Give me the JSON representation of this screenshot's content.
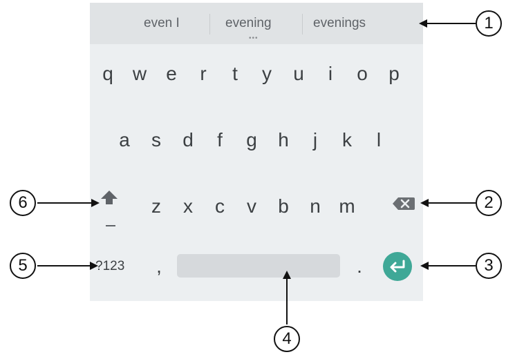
{
  "suggestions": [
    "even I",
    "evening",
    "evenings"
  ],
  "rows": [
    [
      "q",
      "w",
      "e",
      "r",
      "t",
      "y",
      "u",
      "i",
      "o",
      "p"
    ],
    [
      "a",
      "s",
      "d",
      "f",
      "g",
      "h",
      "j",
      "k",
      "l"
    ],
    [
      "z",
      "x",
      "c",
      "v",
      "b",
      "n",
      "m"
    ]
  ],
  "bottom_row": {
    "symbols_label": "?123",
    "comma": ",",
    "period": "."
  },
  "callouts": [
    "1",
    "2",
    "3",
    "4",
    "5",
    "6"
  ],
  "colors": {
    "keyboard_bg": "#eceff1",
    "suggestion_bg": "#e0e3e5",
    "enter_accent": "#3fa897",
    "key_text": "#3c4043"
  },
  "icons": {
    "shift": "shift-arrow-up-icon",
    "backspace": "backspace-icon",
    "enter": "enter-return-icon"
  }
}
